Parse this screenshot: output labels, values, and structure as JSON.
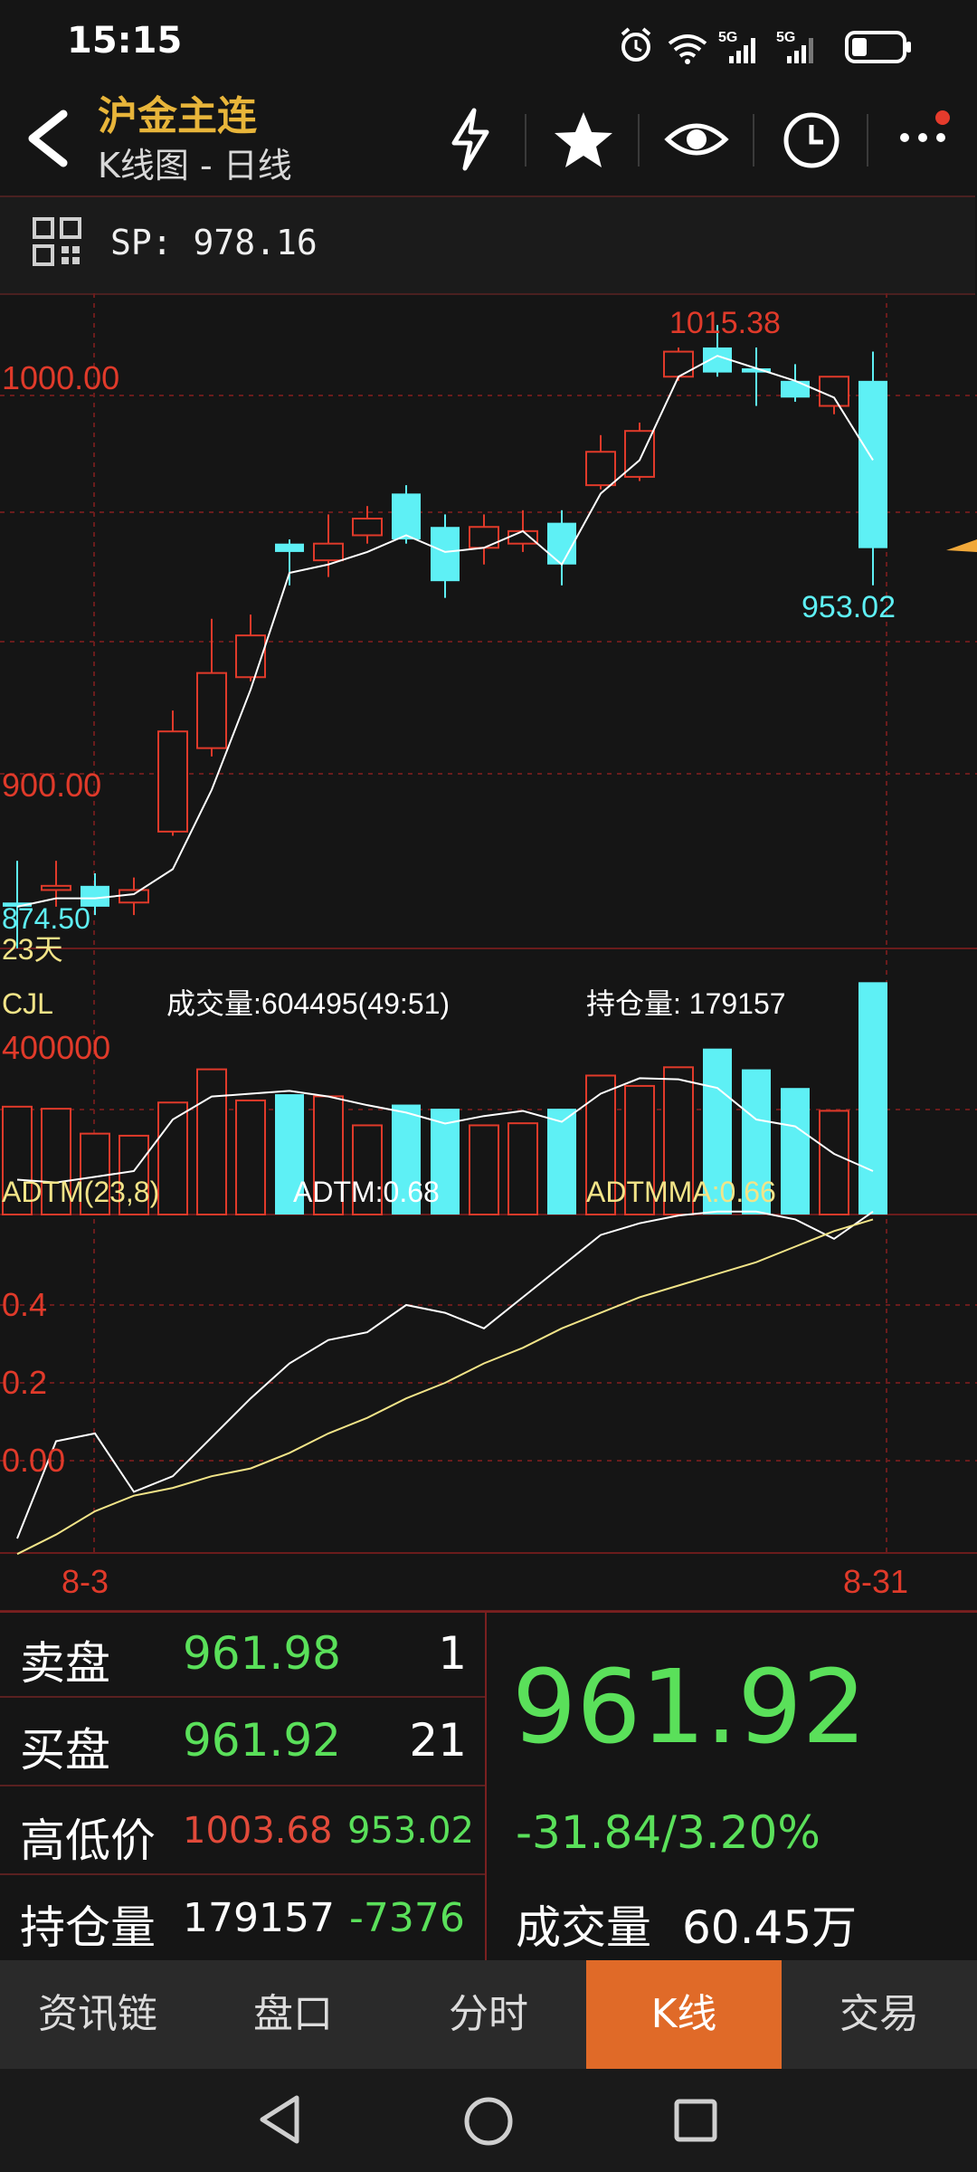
{
  "status_bar": {
    "time": "15:15",
    "signal1_label": "5G",
    "signal2_label": "5G",
    "icons": [
      "alarm-icon",
      "wifi-icon",
      "signal-icon",
      "signal-icon",
      "battery-icon"
    ]
  },
  "header": {
    "title": "沪金主连",
    "subtitle": "K线图 - 日线",
    "actions": [
      "flash-icon",
      "star-icon",
      "eye-icon",
      "clock-icon",
      "more-icon"
    ]
  },
  "sp_bar": {
    "text": "SP: 978.16"
  },
  "chart_data": [
    {
      "type": "candlestick",
      "price_labels": [
        "1000.00",
        "900.00"
      ],
      "high_label": "1015.38",
      "low_label": "953.02",
      "left_label": "874.50",
      "period_label": "23天",
      "date_labels": [
        "8-3",
        "8-31"
      ],
      "ylim": [
        866,
        1023
      ],
      "candles": [
        {
          "o": 876,
          "c": 877,
          "h": 887,
          "l": 866,
          "dir": "down"
        },
        {
          "o": 880,
          "c": 881,
          "h": 887,
          "l": 876,
          "dir": "up"
        },
        {
          "o": 881,
          "c": 876,
          "h": 884,
          "l": 874,
          "dir": "down"
        },
        {
          "o": 877,
          "c": 880,
          "h": 883,
          "l": 874,
          "dir": "up"
        },
        {
          "o": 894,
          "c": 918,
          "h": 923,
          "l": 893,
          "dir": "up"
        },
        {
          "o": 914,
          "c": 932,
          "h": 945,
          "l": 912,
          "dir": "up"
        },
        {
          "o": 931,
          "c": 941,
          "h": 946,
          "l": 930,
          "dir": "up"
        },
        {
          "o": 963,
          "c": 961,
          "h": 964,
          "l": 953,
          "dir": "down"
        },
        {
          "o": 959,
          "c": 963,
          "h": 970,
          "l": 955,
          "dir": "up"
        },
        {
          "o": 965,
          "c": 969,
          "h": 972,
          "l": 963,
          "dir": "up"
        },
        {
          "o": 975,
          "c": 964,
          "h": 977,
          "l": 963,
          "dir": "down"
        },
        {
          "o": 967,
          "c": 954,
          "h": 970,
          "l": 950,
          "dir": "down"
        },
        {
          "o": 962,
          "c": 967,
          "h": 970,
          "l": 958,
          "dir": "up"
        },
        {
          "o": 963,
          "c": 966,
          "h": 971,
          "l": 961,
          "dir": "up"
        },
        {
          "o": 968,
          "c": 958,
          "h": 971,
          "l": 953,
          "dir": "down"
        },
        {
          "o": 977,
          "c": 985,
          "h": 989,
          "l": 976,
          "dir": "up"
        },
        {
          "o": 979,
          "c": 990,
          "h": 992,
          "l": 978,
          "dir": "up"
        },
        {
          "o": 1003,
          "c": 1009,
          "h": 1010,
          "l": 1002,
          "dir": "up"
        },
        {
          "o": 1010,
          "c": 1004,
          "h": 1015.38,
          "l": 1003,
          "dir": "down"
        },
        {
          "o": 1005,
          "c": 1004,
          "h": 1010,
          "l": 996,
          "dir": "down"
        },
        {
          "o": 1002,
          "c": 998,
          "h": 1006,
          "l": 997,
          "dir": "down"
        },
        {
          "o": 996,
          "c": 1003,
          "h": 1003,
          "l": 994,
          "dir": "up"
        },
        {
          "o": 1002,
          "c": 961.92,
          "h": 1009,
          "l": 953.02,
          "dir": "down"
        }
      ],
      "ma_line": [
        876,
        878,
        878,
        879,
        885,
        904,
        928,
        956,
        958,
        961,
        965,
        961,
        962,
        966,
        958,
        975,
        983,
        1003,
        1008,
        1005,
        1002,
        998,
        983
      ]
    },
    {
      "type": "bar",
      "series_label": "CJL",
      "volume_label": "成交量:604495(49:51)",
      "oi_label": "持仓量: 179157",
      "axis_label": "400000",
      "ylim": [
        0,
        480000
      ],
      "values": [
        260000,
        255000,
        195000,
        190000,
        270000,
        350000,
        275000,
        290000,
        285000,
        215000,
        265000,
        255000,
        215000,
        220000,
        255000,
        335000,
        310000,
        355000,
        400000,
        350000,
        305000,
        250000,
        560000
      ],
      "dirs": [
        "up",
        "up",
        "up",
        "up",
        "up",
        "up",
        "up",
        "down",
        "up",
        "up",
        "down",
        "down",
        "up",
        "up",
        "down",
        "up",
        "up",
        "up",
        "down",
        "down",
        "down",
        "up",
        "down"
      ],
      "oi_line": [
        145000,
        140000,
        150000,
        160000,
        250000,
        290000,
        295000,
        300000,
        290000,
        275000,
        262000,
        243000,
        256000,
        265000,
        246000,
        295000,
        322000,
        320000,
        305000,
        250000,
        238000,
        190000,
        160000
      ]
    },
    {
      "type": "line",
      "title": "ADTM(23,8)",
      "adtm_label": "ADTM:0.68",
      "adtmma_label": "ADTMMA:0.66",
      "y_labels": [
        "0.4",
        "0.2",
        "0.00"
      ],
      "ylim": [
        -0.24,
        0.8
      ],
      "adtm": [
        -0.2,
        0.05,
        0.07,
        -0.08,
        -0.04,
        0.06,
        0.16,
        0.25,
        0.31,
        0.33,
        0.4,
        0.38,
        0.34,
        0.42,
        0.5,
        0.58,
        0.61,
        0.63,
        0.64,
        0.64,
        0.62,
        0.57,
        0.64
      ],
      "adtmma": [
        -0.24,
        -0.19,
        -0.13,
        -0.09,
        -0.07,
        -0.04,
        -0.02,
        0.02,
        0.07,
        0.11,
        0.16,
        0.2,
        0.25,
        0.29,
        0.34,
        0.38,
        0.42,
        0.45,
        0.48,
        0.51,
        0.55,
        0.59,
        0.62
      ]
    }
  ],
  "quote": {
    "ask_label": "卖盘",
    "ask_price": "961.98",
    "ask_qty": "1",
    "bid_label": "买盘",
    "bid_price": "961.92",
    "bid_qty": "21",
    "hl_label": "高低价",
    "high": "1003.68",
    "low": "953.02",
    "oi_label": "持仓量",
    "oi": "179157",
    "oi_change": "-7376",
    "last_price": "961.92",
    "change": "-31.84/3.20%",
    "volume_label": "成交量",
    "volume": "60.45万"
  },
  "tabs": [
    {
      "label": "资讯链"
    },
    {
      "label": "盘口"
    },
    {
      "label": "分时"
    },
    {
      "label": "K线",
      "active": true
    },
    {
      "label": "交易"
    }
  ],
  "colors": {
    "up": "#e03a2a",
    "down": "#5ef0f5",
    "ma": "#ffffff",
    "adtmma": "#f2e488",
    "accent": "#e06a28",
    "gold": "#e8b53a"
  }
}
